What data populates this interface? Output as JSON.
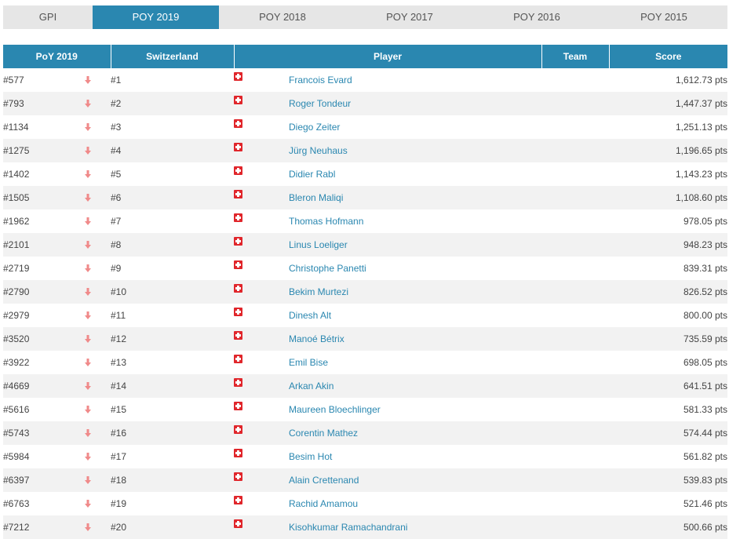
{
  "tabs": [
    {
      "label": "GPI",
      "active": false
    },
    {
      "label": "POY 2019",
      "active": true
    },
    {
      "label": "POY 2018",
      "active": false
    },
    {
      "label": "POY 2017",
      "active": false
    },
    {
      "label": "POY 2016",
      "active": false
    },
    {
      "label": "POY 2015",
      "active": false
    }
  ],
  "table": {
    "headers": {
      "poy": "PoY 2019",
      "country": "Switzerland",
      "player": "Player",
      "team": "Team",
      "score": "Score"
    },
    "colors": {
      "accent": "#2a87b0",
      "arrow": "#f08a8a",
      "flag": "#e0262b"
    },
    "rows": [
      {
        "poy": "#577",
        "rank": "#1",
        "player": "Francois Evard",
        "team": "",
        "score": "1,612.73 pts"
      },
      {
        "poy": "#793",
        "rank": "#2",
        "player": "Roger Tondeur",
        "team": "",
        "score": "1,447.37 pts"
      },
      {
        "poy": "#1134",
        "rank": "#3",
        "player": "Diego Zeiter",
        "team": "",
        "score": "1,251.13 pts"
      },
      {
        "poy": "#1275",
        "rank": "#4",
        "player": "Jürg Neuhaus",
        "team": "",
        "score": "1,196.65 pts"
      },
      {
        "poy": "#1402",
        "rank": "#5",
        "player": "Didier Rabl",
        "team": "",
        "score": "1,143.23 pts"
      },
      {
        "poy": "#1505",
        "rank": "#6",
        "player": "Bleron Maliqi",
        "team": "",
        "score": "1,108.60 pts"
      },
      {
        "poy": "#1962",
        "rank": "#7",
        "player": "Thomas Hofmann",
        "team": "",
        "score": "978.05 pts"
      },
      {
        "poy": "#2101",
        "rank": "#8",
        "player": "Linus Loeliger",
        "team": "",
        "score": "948.23 pts"
      },
      {
        "poy": "#2719",
        "rank": "#9",
        "player": "Christophe Panetti",
        "team": "",
        "score": "839.31 pts"
      },
      {
        "poy": "#2790",
        "rank": "#10",
        "player": "Bekim Murtezi",
        "team": "",
        "score": "826.52 pts"
      },
      {
        "poy": "#2979",
        "rank": "#11",
        "player": "Dinesh Alt",
        "team": "",
        "score": "800.00 pts"
      },
      {
        "poy": "#3520",
        "rank": "#12",
        "player": "Manoé Bétrix",
        "team": "",
        "score": "735.59 pts"
      },
      {
        "poy": "#3922",
        "rank": "#13",
        "player": "Emil Bise",
        "team": "",
        "score": "698.05 pts"
      },
      {
        "poy": "#4669",
        "rank": "#14",
        "player": "Arkan Akin",
        "team": "",
        "score": "641.51 pts"
      },
      {
        "poy": "#5616",
        "rank": "#15",
        "player": "Maureen Bloechlinger",
        "team": "",
        "score": "581.33 pts"
      },
      {
        "poy": "#5743",
        "rank": "#16",
        "player": "Corentin Mathez",
        "team": "",
        "score": "574.44 pts"
      },
      {
        "poy": "#5984",
        "rank": "#17",
        "player": "Besim Hot",
        "team": "",
        "score": "561.82 pts"
      },
      {
        "poy": "#6397",
        "rank": "#18",
        "player": "Alain Crettenand",
        "team": "",
        "score": "539.83 pts"
      },
      {
        "poy": "#6763",
        "rank": "#19",
        "player": "Rachid Amamou",
        "team": "",
        "score": "521.46 pts"
      },
      {
        "poy": "#7212",
        "rank": "#20",
        "player": "Kisohkumar Ramachandrani",
        "team": "",
        "score": "500.66 pts"
      }
    ]
  }
}
